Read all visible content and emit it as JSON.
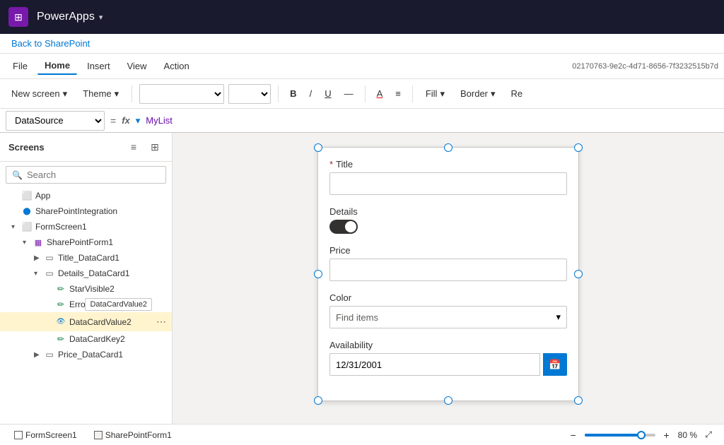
{
  "app": {
    "name": "PowerApps",
    "chevron": "▾",
    "grid_icon": "⊞"
  },
  "breadcrumb": {
    "link_text": "Back to SharePoint"
  },
  "menu": {
    "items": [
      "File",
      "Home",
      "Insert",
      "View",
      "Action"
    ],
    "active": "Home",
    "session_id": "02170763-9e2c-4d71-8656-7f3232515b7d"
  },
  "toolbar": {
    "new_screen_label": "New screen",
    "new_screen_chevron": "▾",
    "theme_label": "Theme",
    "theme_chevron": "▾",
    "bold_label": "B",
    "italic_label": "/",
    "underline_label": "U",
    "strikethrough_label": "—",
    "font_color_label": "A",
    "align_label": "≡",
    "fill_label": "Fill",
    "border_label": "Border",
    "reorder_label": "Re"
  },
  "formula_bar": {
    "dropdown_value": "DataSource",
    "eq_symbol": "=",
    "fx_label": "fx",
    "formula_value": "MyList"
  },
  "sidebar": {
    "title": "Screens",
    "search_placeholder": "Search",
    "tree_items": [
      {
        "id": "app",
        "label": "App",
        "indent": 1,
        "icon": "app",
        "has_chevron": false
      },
      {
        "id": "sharepoint-integration",
        "label": "SharePointIntegration",
        "indent": 1,
        "icon": "sp",
        "has_chevron": false
      },
      {
        "id": "form-screen",
        "label": "FormScreen1",
        "indent": 1,
        "icon": "screen",
        "has_chevron": true,
        "expanded": true
      },
      {
        "id": "sharepoint-form",
        "label": "SharePointForm1",
        "indent": 2,
        "icon": "form",
        "has_chevron": true,
        "expanded": true
      },
      {
        "id": "title-card",
        "label": "Title_DataCard1",
        "indent": 3,
        "icon": "card",
        "has_chevron": true,
        "expanded": false
      },
      {
        "id": "details-card",
        "label": "Details_DataCard1",
        "indent": 3,
        "icon": "card",
        "has_chevron": true,
        "expanded": true
      },
      {
        "id": "star-visible",
        "label": "StarVisible2",
        "indent": 4,
        "icon": "pen",
        "has_chevron": false
      },
      {
        "id": "error-msg",
        "label": "ErrorM",
        "indent": 4,
        "icon": "pen",
        "has_chevron": false,
        "tooltip": "DataCardValue2"
      },
      {
        "id": "datacardvalue2",
        "label": "DataCardValue2",
        "indent": 4,
        "icon": "eye",
        "has_chevron": false,
        "selected": true,
        "highlighted": true
      },
      {
        "id": "datacardkey2",
        "label": "DataCardKey2",
        "indent": 4,
        "icon": "pen",
        "has_chevron": false
      },
      {
        "id": "price-card",
        "label": "Price_DataCard1",
        "indent": 3,
        "icon": "card",
        "has_chevron": true,
        "expanded": false
      }
    ]
  },
  "form": {
    "title_field": {
      "label": "Title",
      "required": true,
      "value": ""
    },
    "details_field": {
      "label": "Details",
      "toggle_state": "on"
    },
    "price_field": {
      "label": "Price",
      "value": ""
    },
    "color_field": {
      "label": "Color",
      "placeholder": "Find items",
      "chevron": "▾"
    },
    "availability_field": {
      "label": "Availability",
      "value": "12/31/2001",
      "calendar_icon": "📅"
    }
  },
  "bottom_bar": {
    "tab1_label": "FormScreen1",
    "tab2_label": "SharePointForm1",
    "zoom_minus": "−",
    "zoom_plus": "+",
    "zoom_value": "80 %",
    "zoom_percent": 80,
    "expand_icon": "⤢"
  }
}
